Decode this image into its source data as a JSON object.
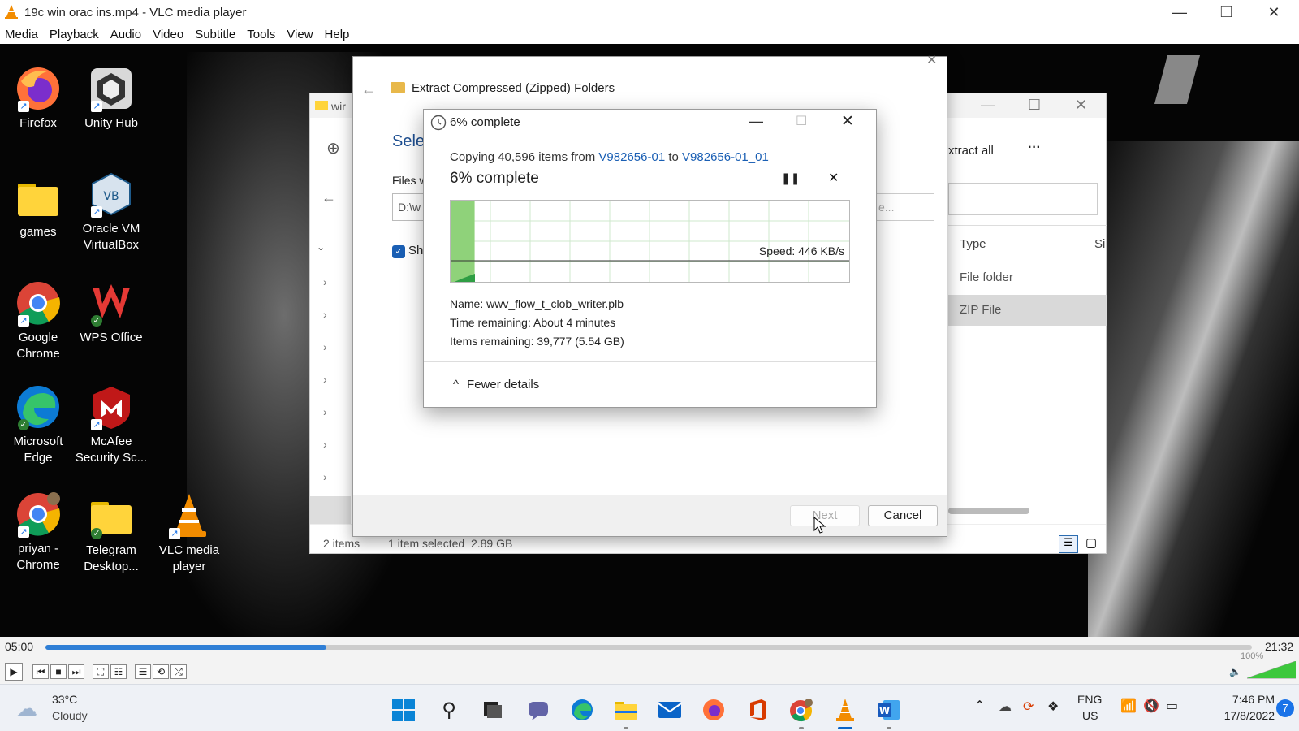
{
  "vlc": {
    "title": "19c win orac ins.mp4 - VLC media player",
    "menu": [
      "Media",
      "Playback",
      "Audio",
      "Video",
      "Subtitle",
      "Tools",
      "View",
      "Help"
    ],
    "time_elapsed": "05:00",
    "time_total": "21:32",
    "seek_progress": 0.233,
    "volume_label": "100%",
    "volume_level": 1.0
  },
  "desktop": {
    "icons": [
      {
        "label": "Firefox"
      },
      {
        "label": "Unity Hub"
      },
      {
        "label": "games"
      },
      {
        "label": "Oracle VM VirtualBox"
      },
      {
        "label": "Google Chrome"
      },
      {
        "label": "WPS Office"
      },
      {
        "label": "Microsoft Edge"
      },
      {
        "label": "McAfee Security Sc..."
      },
      {
        "label": "priyan - Chrome"
      },
      {
        "label": "Telegram Desktop..."
      },
      {
        "label": "VLC media player"
      }
    ]
  },
  "explorer": {
    "tab_fragment": "wir",
    "extract_all": "xtract all",
    "more": "···",
    "col_type": "Type",
    "col_size": "Si",
    "rows": [
      {
        "type": "File folder"
      },
      {
        "type": "ZIP File"
      }
    ],
    "status_items": "2 items",
    "status_selected": "1 item selected  2.89 GB"
  },
  "wizard": {
    "title": "Extract Compressed (Zipped) Folders",
    "heading_fragment": "Sele",
    "files_fragment": "Files w",
    "path_fragment": "D:\\w",
    "browse_fragment": "e...",
    "show_fragment": "Sh",
    "next_label": "Next",
    "cancel_label": "Cancel"
  },
  "copy": {
    "title": "6% complete",
    "line_prefix": "Copying 40,596 items from ",
    "source": "V982656-01",
    "line_mid": " to ",
    "dest": "V982656-01_01",
    "big_status": "6% complete",
    "progress": 0.06,
    "speed": "Speed: 446 KB/s",
    "name_label": "Name:",
    "name_value": "wwv_flow_t_clob_writer.plb",
    "time_label": "Time remaining:",
    "time_value": "About 4 minutes",
    "items_label": "Items remaining:",
    "items_value": "39,777 (5.54 GB)",
    "fewer_details": "Fewer details"
  },
  "taskbar": {
    "weather_temp": "33°C",
    "weather_desc": "Cloudy",
    "lang": "ENG",
    "region": "US",
    "time": "7:46 PM",
    "date": "17/8/2022",
    "notif_count": "7"
  },
  "colors": {
    "accent": "#1a5fb4",
    "progress_green": "#8fd27a",
    "vlc_orange": "#f28c00"
  }
}
